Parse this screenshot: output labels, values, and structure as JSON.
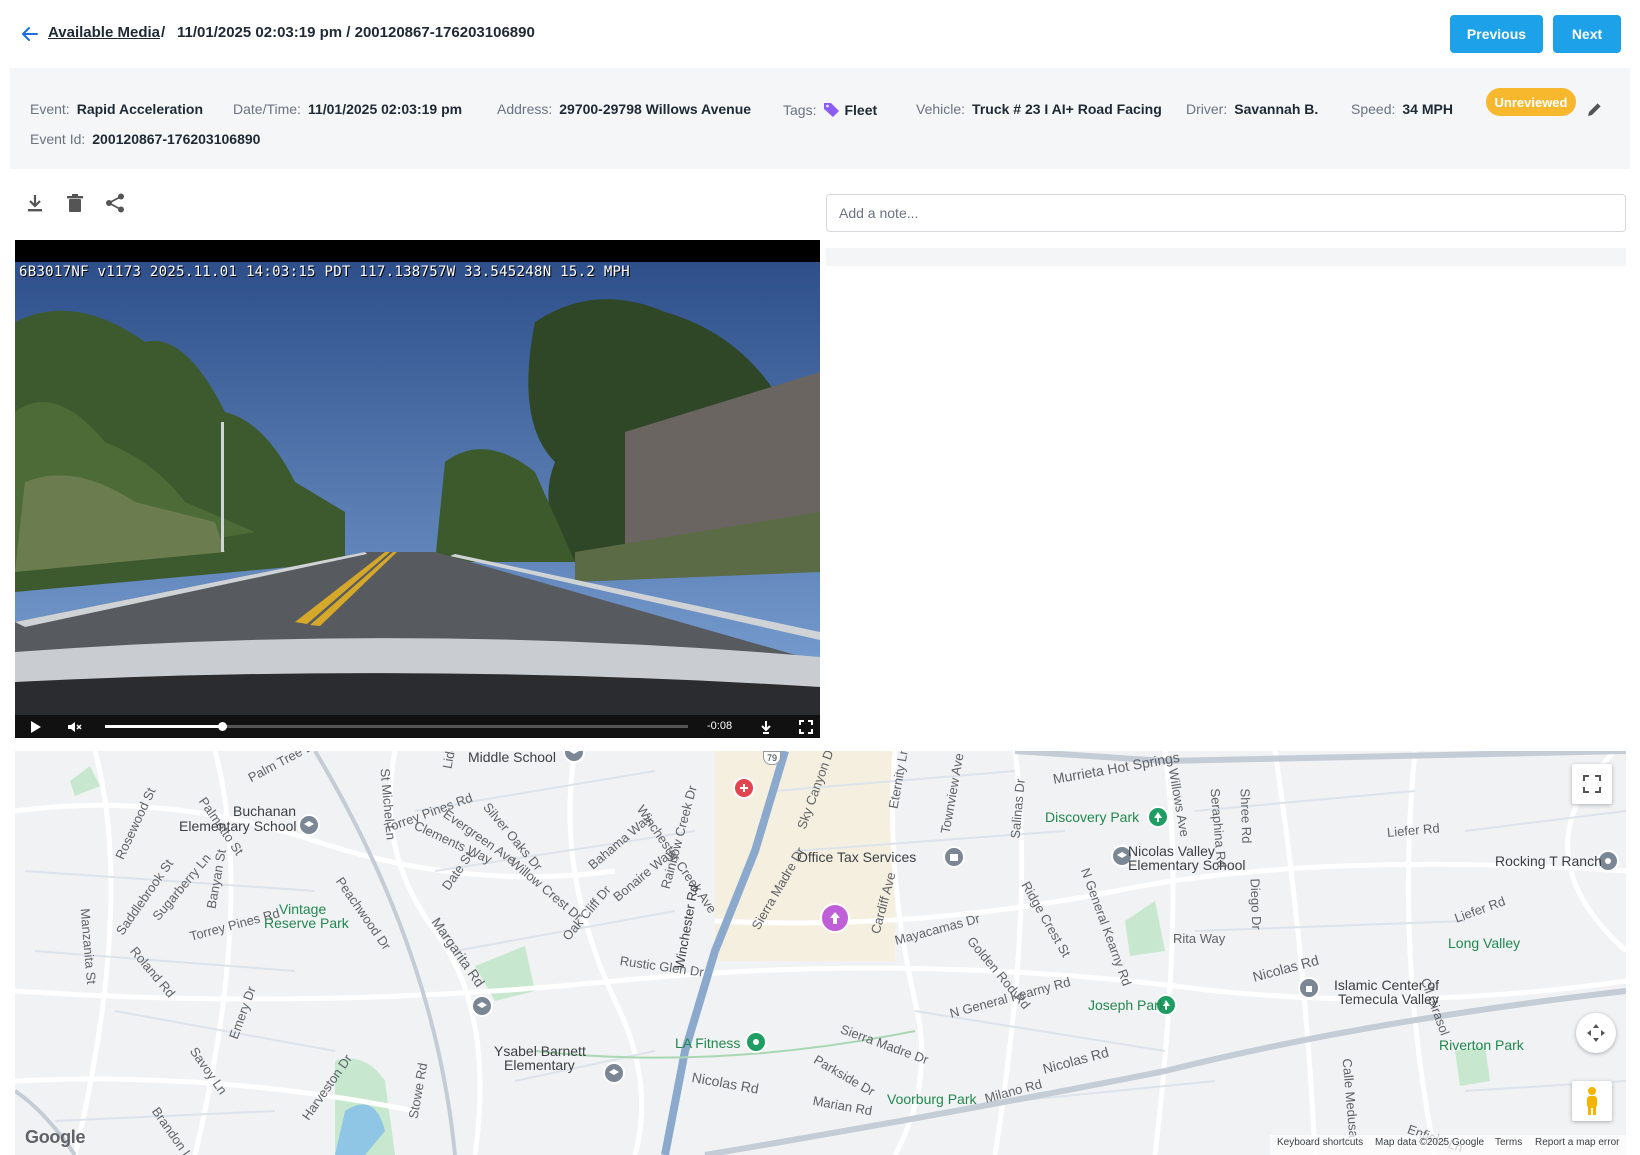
{
  "header": {
    "back_link": "Available Media",
    "separator": "/",
    "title": "11/01/2025 02:03:19 pm / 200120867-176203106890",
    "previous_label": "Previous",
    "next_label": "Next"
  },
  "event": {
    "event_label": "Event:",
    "event_value": "Rapid Acceleration",
    "datetime_label": "Date/Time:",
    "datetime_value": "11/01/2025 02:03:19 pm",
    "address_label": "Address:",
    "address_value": "29700-29798 Willows Avenue",
    "tags_label": "Tags:",
    "tags_value": "Fleet",
    "vehicle_label": "Vehicle:",
    "vehicle_value": "Truck # 23 I AI+ Road Facing",
    "driver_label": "Driver:",
    "driver_value": "Savannah B.",
    "speed_label": "Speed:",
    "speed_value": "34 MPH",
    "status_badge": "Unreviewed",
    "event_id_label": "Event Id:",
    "event_id_value": "200120867-176203106890"
  },
  "toolbar": {
    "icons": [
      "download-icon",
      "trash-icon",
      "share-icon"
    ]
  },
  "note": {
    "placeholder": "Add a note..."
  },
  "video": {
    "overlay_text": "6B3017NF v1173 2025.11.01 14:03:15 PDT 117.138757W 33.545248N 15.2 MPH",
    "time_remaining": "-0:08",
    "progress_fraction": 0.2
  },
  "map": {
    "labels": [
      "Middle School",
      "Palm Tree Ln",
      "St Michel Ln",
      "Lido Dr",
      "Torrey Pines Rd",
      "Evergreen Ave",
      "Silver Oaks Dr",
      "Bahama Way",
      "Winchester Creek Ave",
      "Sky Canyon Dr",
      "Eternity Ln",
      "Townview Ave",
      "Murrieta Hot Springs",
      "Willows Ave",
      "Shree Rd",
      "Palmetto St",
      "Rosewood St",
      "Manzanita St",
      "Saddlebrook St",
      "Sugarberry Ln",
      "Banyan St",
      "Buchanan",
      "Elementary School",
      "Clements Way",
      "Willow Crest Dr",
      "Bonaire Way",
      "Rainbow Creek Dr",
      "Office Tax Services",
      "Salinas Dr",
      "Discovery Park",
      "Nicolas Valley",
      "Elementary School",
      "N General Kearny Rd",
      "Seraphina Rd",
      "Diego Dr",
      "Liefer Rd",
      "Rocking T Ranch",
      "Vintage",
      "Reserve Park",
      "Peachwood Dr",
      "Date St",
      "Margarita Rd",
      "Oak Cliff Dr",
      "Torrey Pines Rd",
      "Roland Rd",
      "Sierra Madre Dr",
      "Cardiff Ave",
      "Mayacamas Dr",
      "Golden Rod Rd",
      "Ridge Crest St",
      "Rita Way",
      "Nicolas Rd",
      "Long Valley",
      "Liefer Rd",
      "Rustic Glen Dr",
      "Winchester Rd",
      "Ysabel Barnett",
      "Elementary",
      "Emery Dr",
      "Savoy Ln",
      "Brandon Ln",
      "Harveston Dr",
      "Stowe Rd",
      "Joseph Park",
      "N General Kearny Rd",
      "Islamic Center of",
      "Temecula Valley",
      "Calle Medusa",
      "Cll Girasol",
      "LA Fitness",
      "Sierra Madre Dr",
      "Parkside Dr",
      "Nicolas Rd",
      "Marian Rd",
      "Voorburg Park",
      "Milano Rd",
      "Nicolas Rd",
      "Riverton Park",
      "Enfield Ln",
      "79"
    ],
    "attribution": {
      "logo": "Google",
      "keyboard": "Keyboard shortcuts",
      "data": "Map data ©2025 Google",
      "terms": "Terms",
      "report": "Report a map error"
    },
    "icons": [
      "fullscreen-icon",
      "camera-control-icon",
      "pegman-icon",
      "vehicle-marker-icon"
    ]
  },
  "colors": {
    "accent": "#1da1e8",
    "badge": "#f8b82e",
    "tag": "#8b5cf6",
    "marker": "#c060d8",
    "park_green": "#22874f"
  }
}
